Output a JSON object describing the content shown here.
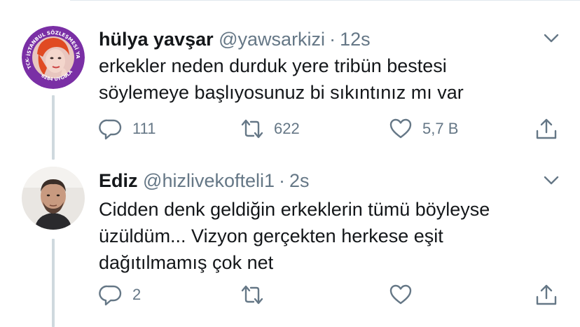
{
  "tweets": [
    {
      "display_name": "hülya yavşar",
      "handle": "@yawsarkizi",
      "time": "12s",
      "text_lines": [
        "erkekler neden durduk yere tribün bestesi",
        "söylemeye başlıyosunuz bi sıkıntınız mı var"
      ],
      "avatar_badge": {
        "top_text": "İSTANBUL SÖZLEŞMESİ YAŞATIR",
        "left_text": "TCK-103",
        "bottom_text": "6284 UYGULA"
      },
      "actions": {
        "reply": "111",
        "retweet": "622",
        "like": "5,7 B"
      }
    },
    {
      "display_name": "Ediz",
      "handle": "@hizlivekofteli1",
      "time": "2s",
      "text_lines": [
        "Cidden denk geldiğin erkeklerin tümü böyleyse",
        "üzüldüm... Vizyon gerçekten herkese eşit",
        "dağıtılmamış çok net"
      ],
      "actions": {
        "reply": "2",
        "retweet": "",
        "like": ""
      }
    }
  ],
  "icons": [
    "reply-icon",
    "retweet-icon",
    "like-icon",
    "share-icon",
    "chevron-down-icon"
  ],
  "colors": {
    "text": "#14171a",
    "secondary": "#657786",
    "badge_purple": "#7a2fa5",
    "line": "#cfd9de"
  }
}
